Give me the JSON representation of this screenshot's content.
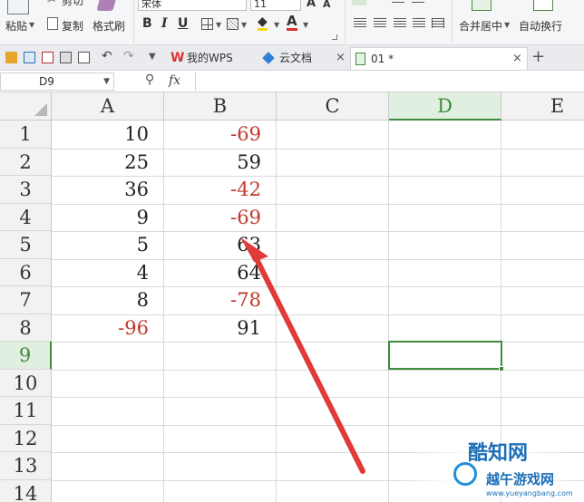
{
  "ribbon": {
    "paste": "粘贴",
    "cut": "剪切",
    "copy": "复制",
    "format_painter": "格式刷",
    "font_name": "宋体",
    "font_size": "11",
    "bold": "B",
    "italic": "I",
    "underline": "U",
    "merge_center": "合并居中",
    "wrap_text": "自动换行"
  },
  "tabs": {
    "wps": "我的WPS",
    "cloud": "云文档",
    "doc": "01 *"
  },
  "formula_bar": {
    "name_box": "D9",
    "fx": "fx"
  },
  "columns": [
    "A",
    "B",
    "C",
    "D",
    "E"
  ],
  "rows": [
    "1",
    "2",
    "3",
    "4",
    "5",
    "6",
    "7",
    "8",
    "9",
    "10",
    "11",
    "12",
    "13",
    "14"
  ],
  "cells": {
    "a": [
      "10",
      "25",
      "36",
      "9",
      "5",
      "4",
      "8",
      "-96"
    ],
    "b": [
      "-69",
      "59",
      "-42",
      "-69",
      "63",
      "64",
      "-78",
      "91"
    ]
  },
  "watermark": {
    "brand": "酷知网",
    "brand2": "越午游戏网",
    "url": "www.yueyangbang.com"
  },
  "colors": {
    "negative": "#c0392b",
    "selection": "#3f8b3d",
    "arrow": "#e03a3a"
  }
}
